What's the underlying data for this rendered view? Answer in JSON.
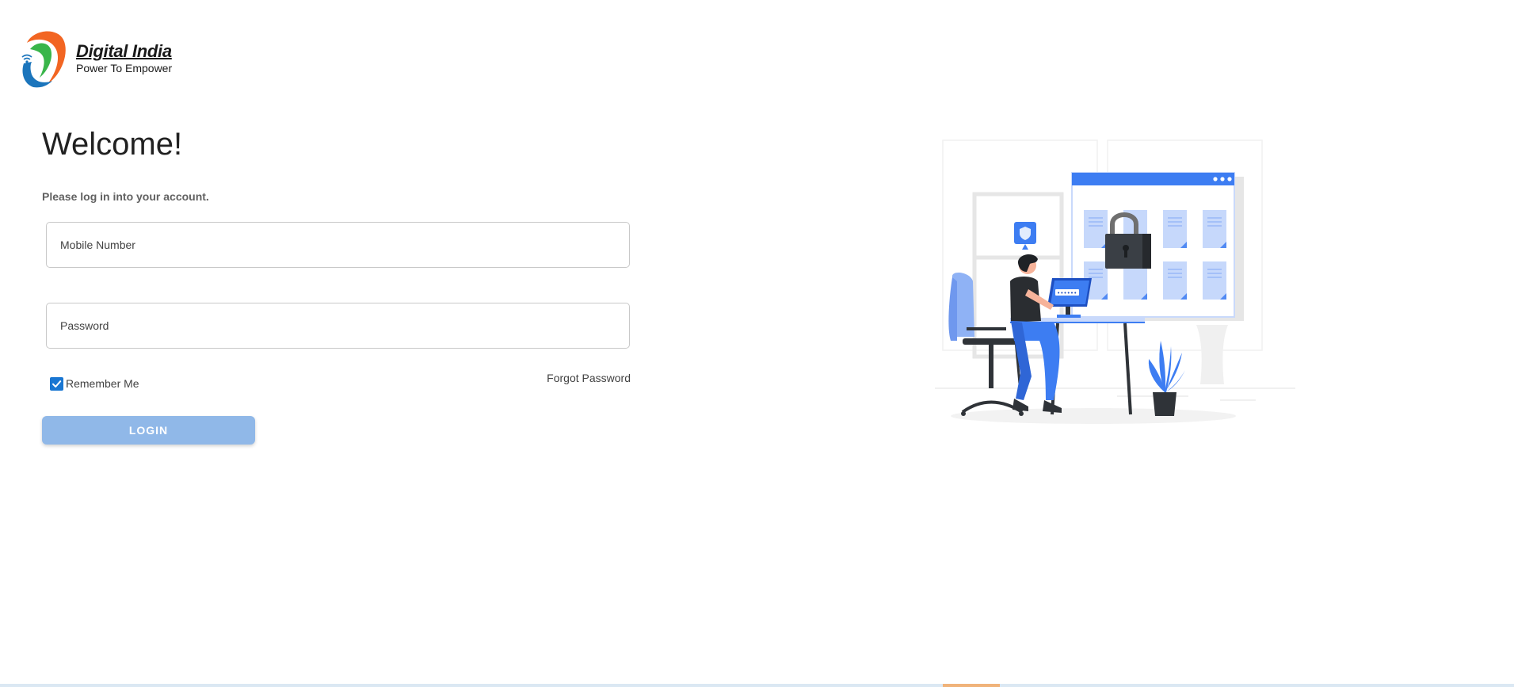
{
  "brand": {
    "title": "Digital India",
    "tagline": "Power To Empower",
    "colors": {
      "saffron": "#f26522",
      "blue": "#1b75bc",
      "green": "#39b54a"
    }
  },
  "login": {
    "heading": "Welcome!",
    "subtitle": "Please log in into your account.",
    "mobile_placeholder": "Mobile Number",
    "password_placeholder": "Password",
    "remember_label": "Remember Me",
    "remember_checked": true,
    "forgot_label": "Forgot Password",
    "submit_label": "LOGIN"
  },
  "illustration": {
    "icon": "secure-login-illustration",
    "password_mask": "••••••"
  },
  "theme": {
    "accent": "#1976d2",
    "button_disabled": "#90b8e8",
    "illustration_blue": "#3d7df2"
  }
}
